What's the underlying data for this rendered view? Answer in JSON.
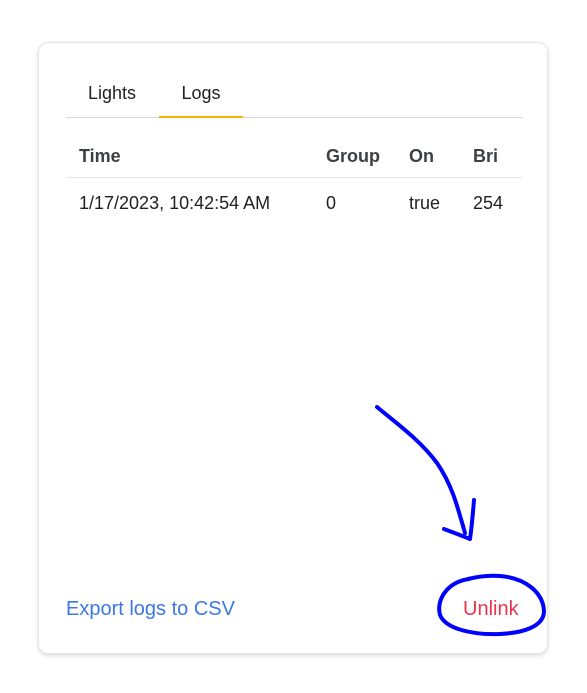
{
  "tabs": [
    {
      "label": "Lights",
      "active": false
    },
    {
      "label": "Logs",
      "active": true
    }
  ],
  "log_table": {
    "columns": [
      "Time",
      "Group",
      "On",
      "Bri"
    ],
    "rows": [
      [
        "1/17/2023, 10:42:54 AM",
        "0",
        "true",
        "254"
      ]
    ]
  },
  "footer": {
    "export_label": "Export logs to CSV",
    "unlink_label": "Unlink"
  },
  "colors": {
    "tab_indicator": "#f5b400",
    "export_link": "#3b78e7",
    "unlink_link": "#e8364d",
    "annotation_ink": "#0000ff"
  },
  "annotation": {
    "shapes": [
      "hand-drawn-arrow",
      "hand-drawn-circle"
    ]
  }
}
